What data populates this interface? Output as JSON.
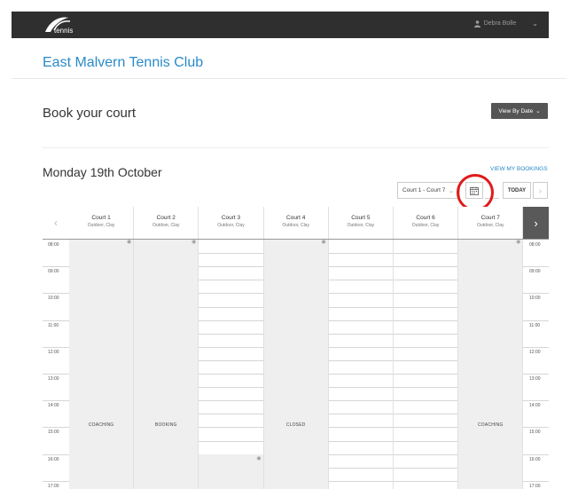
{
  "topbar": {
    "logo_text": "tennis",
    "user_name": "Debra Bolle",
    "user_menu_icon": "chevron-down-icon"
  },
  "club": {
    "name": "East Malvern Tennis Club"
  },
  "booking": {
    "title": "Book your court",
    "view_mode_label": "View By Date",
    "date_heading": "Monday 19th October",
    "view_bookings_label": "VIEW MY BOOKINGS",
    "court_range": "Court 1 - Court 7",
    "today_label": "TODAY"
  },
  "courts": [
    {
      "name": "Court 1",
      "surface": "Outdoor, Clay",
      "status": "COACHING"
    },
    {
      "name": "Court 2",
      "surface": "Outdoor, Clay",
      "status": "BOOKING"
    },
    {
      "name": "Court 3",
      "surface": "Outdoor, Clay",
      "status": ""
    },
    {
      "name": "Court 4",
      "surface": "Outdoor, Clay",
      "status": "CLOSED"
    },
    {
      "name": "Court 5",
      "surface": "Outdoor, Clay",
      "status": ""
    },
    {
      "name": "Court 6",
      "surface": "Outdoor, Clay",
      "status": ""
    },
    {
      "name": "Court 7",
      "surface": "Outdoor, Clay",
      "status": "COACHING"
    }
  ],
  "times": [
    "08:00",
    "09:00",
    "10:00",
    "11:00",
    "12:00",
    "13:00",
    "14:00",
    "15:00",
    "16:00",
    "17:00"
  ],
  "colors": {
    "accent": "#2a8ac8",
    "topbar": "#2f2f2f",
    "highlight": "#e01b1b",
    "blocked": "#efefef"
  }
}
